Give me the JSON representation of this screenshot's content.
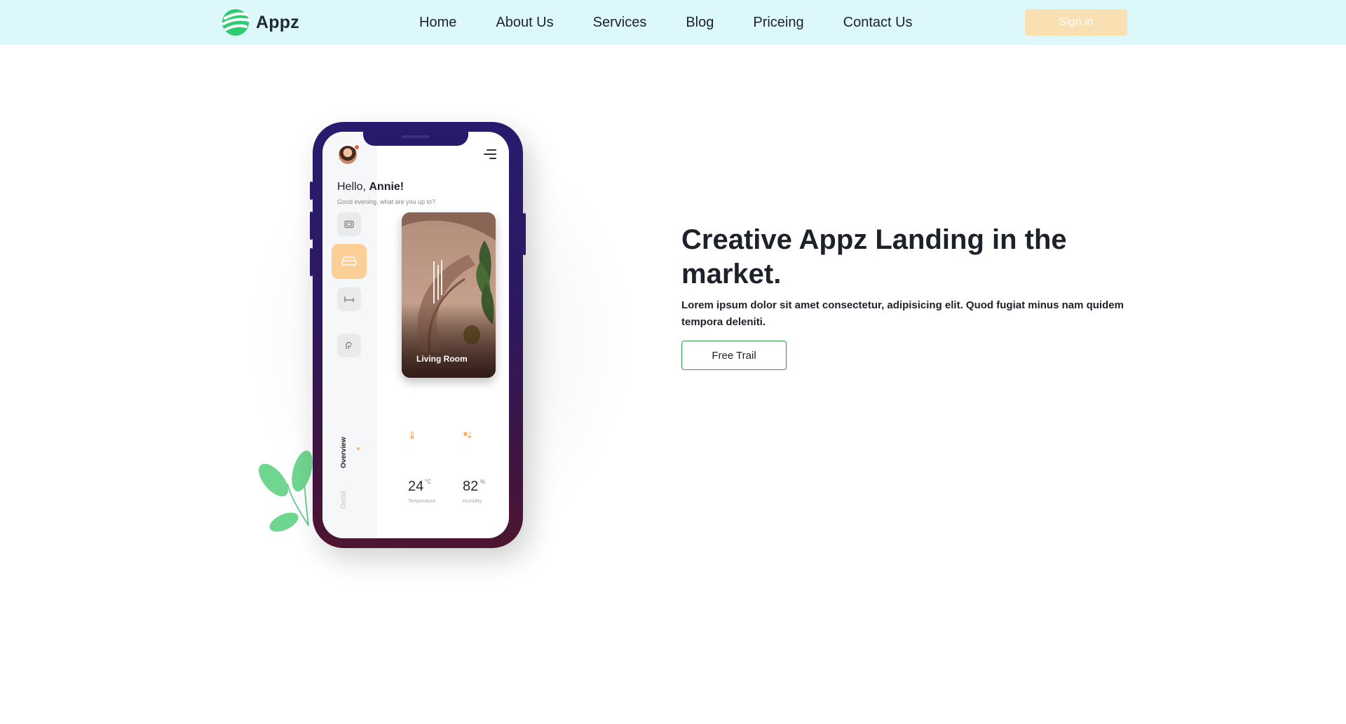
{
  "nav": {
    "logo_text": "Appz",
    "links": [
      "Home",
      "About Us",
      "Services",
      "Blog",
      "Priceing",
      "Contact Us"
    ],
    "signin_label": "Sign in"
  },
  "hero": {
    "title": "Creative Appz Landing in the market.",
    "description": "Lorem ipsum dolor sit amet consectetur, adipisicing elit. Quod fugiat minus nam quidem tempora deleniti.",
    "cta_label": "Free Trail"
  },
  "phone_app": {
    "greeting_prefix": "Hello, ",
    "user_name": "Annie!",
    "greeting_sub": "Good evening, what are you up to?",
    "room_card_label": "Living Room",
    "tabs": [
      "Overview",
      "Detail"
    ],
    "temperature": {
      "value": "24",
      "unit": "°C",
      "label": "Temperature"
    },
    "humidity": {
      "value": "82",
      "unit": "%",
      "label": "Humidity"
    }
  },
  "colors": {
    "navbar_bg": "#ddf8fa",
    "signin_bg": "#f8e0b3",
    "brand_green": "#2ecc71",
    "cta_border": "#2e9a46",
    "active_category": "#fccf96",
    "phone_frame_top": "#2a1a6e",
    "phone_frame_bottom": "#4d1530"
  },
  "icons": {
    "logo": "appz-logo-icon",
    "menu": "menu-icon",
    "categories": [
      "tv-icon",
      "sofa-icon",
      "bed-icon",
      "bath-icon"
    ],
    "temperature": "thermometer-icon",
    "humidity": "humidity-icon"
  }
}
